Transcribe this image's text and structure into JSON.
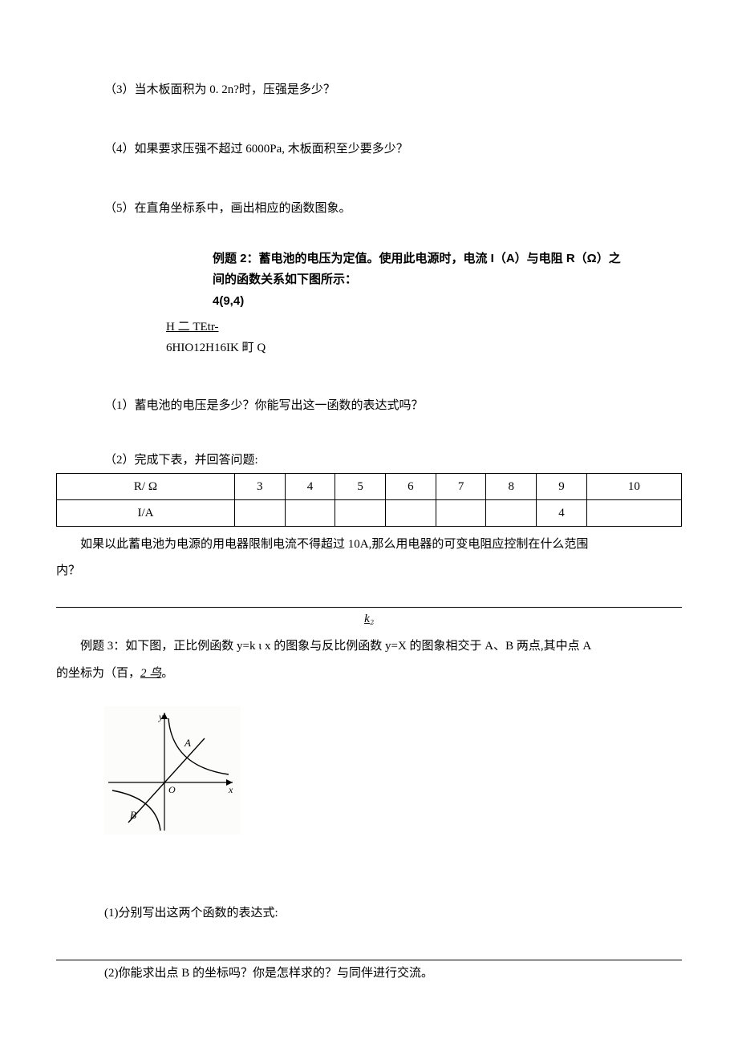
{
  "q3": "（3）当木板面积为 0. 2n?时，压强是多少？",
  "q4": "（4）如果要求压强不超过 6000Pa, 木板面积至少要多少？",
  "q5": "（5）在直角坐标系中，画出相应的函数图象。",
  "example2": {
    "line1": "例题 2：蓄电池的电压为定值。使用此电源时，电流 I（A）与电阻 R（Ω）之",
    "line2": "间的函数关系如下图所示：",
    "coord": "4(9,4)",
    "garble_underlined": "H 二 TEtr-",
    "garble_plain": "6HIO12H16IK 町 Q"
  },
  "sub1": "（1）蓄电池的电压是多少？你能写出这一函数的表达式吗？",
  "sub2_label": "（2）完成下表，并回答问题:",
  "table": {
    "header": [
      "R/ Ω",
      "3",
      "4",
      "5",
      "6",
      "7",
      "8",
      "9",
      "10"
    ],
    "row": [
      "I/A",
      "",
      "",
      "",
      "",
      "",
      "",
      "4",
      ""
    ]
  },
  "followup": "如果以此蓄电池为电源的用电器限制电流不得超过 10A,那么用电器的可变电阻应控制在什么范围",
  "followup2": "内？",
  "k_over": "k₂",
  "example3_line": "例题 3：如下图，正比例函数 y=k ι x 的图象与反比例函数 y=X 的图象相交于 A、B 两点,其中点 A",
  "example3_line2_prefix": "的坐标为（百，",
  "example3_line2_italic": "2 鸟",
  "example3_line2_suffix": "。",
  "q1b": "(1)分别写出这两个函数的表达式:",
  "q2b": "(2)你能求出点 B 的坐标吗？你是怎样求的？与同伴进行交流。"
}
